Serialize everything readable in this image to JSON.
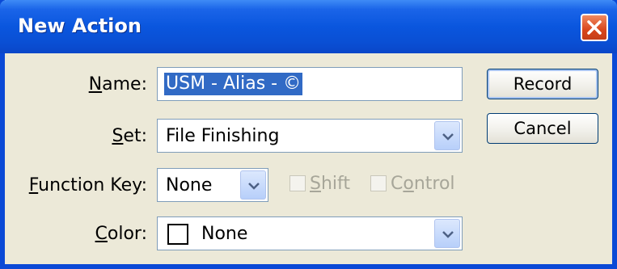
{
  "window": {
    "title": "New Action"
  },
  "form": {
    "name_label_key": "N",
    "name_label_rest": "ame:",
    "name_value": "USM - Alias - ©",
    "set_label_key": "S",
    "set_label_rest": "et:",
    "set_value": "File Finishing",
    "function_key_label_key": "F",
    "function_key_label_rest": "unction Key:",
    "function_key_value": "None",
    "shift_label_key": "S",
    "shift_label_rest": "hift",
    "control_label_pre": "C",
    "control_label_key": "o",
    "control_label_rest": "ntrol",
    "color_label_key": "C",
    "color_label_rest": "olor:",
    "color_value": "None"
  },
  "buttons": {
    "record": "Record",
    "cancel": "Cancel"
  },
  "icons": {
    "close": "close-icon",
    "dropdown": "chevron-down-icon"
  },
  "colors": {
    "titlebar": "#0a56de",
    "selection": "#316ac5",
    "close": "#d9461c",
    "window_bg": "#ece9d8"
  }
}
